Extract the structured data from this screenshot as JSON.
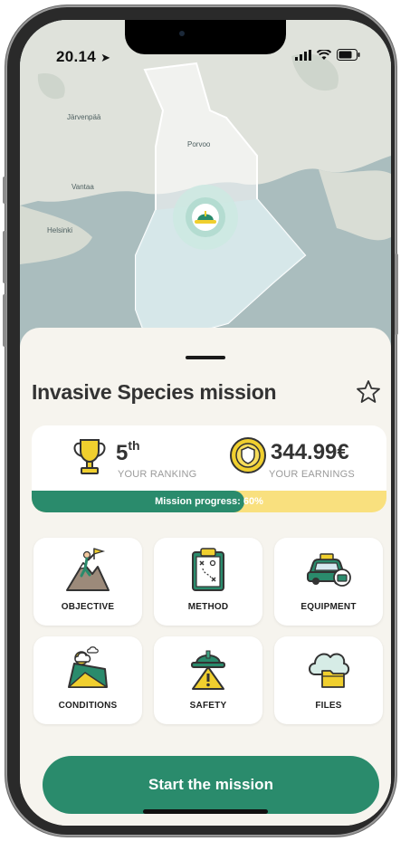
{
  "status_bar": {
    "time": "20.14"
  },
  "map": {
    "labels": {
      "jarvenpaa": "Järvenpää",
      "porvoo": "Porvoo",
      "vantaa": "Vantaa",
      "helsinki": "Helsinki"
    }
  },
  "mission": {
    "title": "Invasive Species mission",
    "ranking": {
      "value": "5",
      "suffix": "th",
      "caption": "YOUR RANKING"
    },
    "earnings": {
      "value": "344.99€",
      "caption": "YOUR EARNINGS"
    },
    "progress": {
      "label": "Mission progress: 60%",
      "percent": 60
    }
  },
  "tiles": {
    "objective": "OBJECTIVE",
    "method": "METHOD",
    "equipment": "EQUIPMENT",
    "conditions": "CONDITIONS",
    "safety": "SAFETY",
    "files": "FILES"
  },
  "start_button": "Start the mission",
  "colors": {
    "accent": "#2a8b6c",
    "progress_track": "#f9e07e",
    "sheet": "#f6f4ee",
    "gold": "#f0cf2e"
  }
}
